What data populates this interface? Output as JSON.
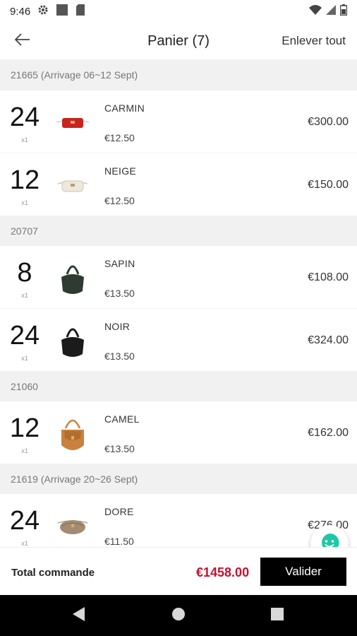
{
  "status_bar": {
    "time": "9:46",
    "left_icons": [
      "gear-icon",
      "square-icon",
      "sim-card-icon"
    ],
    "right_icons": [
      "wifi-icon",
      "signal-icon",
      "battery-icon"
    ]
  },
  "app_bar": {
    "back_icon": "arrow-left-icon",
    "title": "Panier (7)",
    "clear_all": "Enlever tout"
  },
  "groups": [
    {
      "header": "21665 (Arrivage 06~12 Sept)",
      "items": [
        {
          "qty": "24",
          "unit": "x1",
          "name": "CARMIN",
          "unit_price": "€12.50",
          "total": "€300.00",
          "color": "#c8231e"
        },
        {
          "qty": "12",
          "unit": "x1",
          "name": "NEIGE",
          "unit_price": "€12.50",
          "total": "€150.00",
          "color": "#eee7db"
        }
      ]
    },
    {
      "header": "20707",
      "items": [
        {
          "qty": "8",
          "unit": "x1",
          "name": "SAPIN",
          "unit_price": "€13.50",
          "total": "€108.00",
          "color": "#2f3a32"
        },
        {
          "qty": "24",
          "unit": "x1",
          "name": "NOIR",
          "unit_price": "€13.50",
          "total": "€324.00",
          "color": "#1b1b1b"
        }
      ]
    },
    {
      "header": "21060",
      "items": [
        {
          "qty": "12",
          "unit": "x1",
          "name": "CAMEL",
          "unit_price": "€13.50",
          "total": "€162.00",
          "color": "#c9813d"
        }
      ]
    },
    {
      "header": "21619 (Arrivage 20~26 Sept)",
      "items": [
        {
          "qty": "24",
          "unit": "x1",
          "name": "DORE",
          "unit_price": "€11.50",
          "total": "€276.00",
          "color": "#a48b73"
        }
      ]
    }
  ],
  "footer": {
    "total_label": "Total commande",
    "total_value": "€1458.00",
    "validate_label": "Valider"
  },
  "chat_icon": "smiley-chat-icon",
  "nav_bar": [
    "back-triangle-icon",
    "home-circle-icon",
    "recents-square-icon"
  ],
  "colors": {
    "accent_red": "#c8102e",
    "chat_teal": "#1ec8a5",
    "section_bg": "#f1f1f1"
  }
}
